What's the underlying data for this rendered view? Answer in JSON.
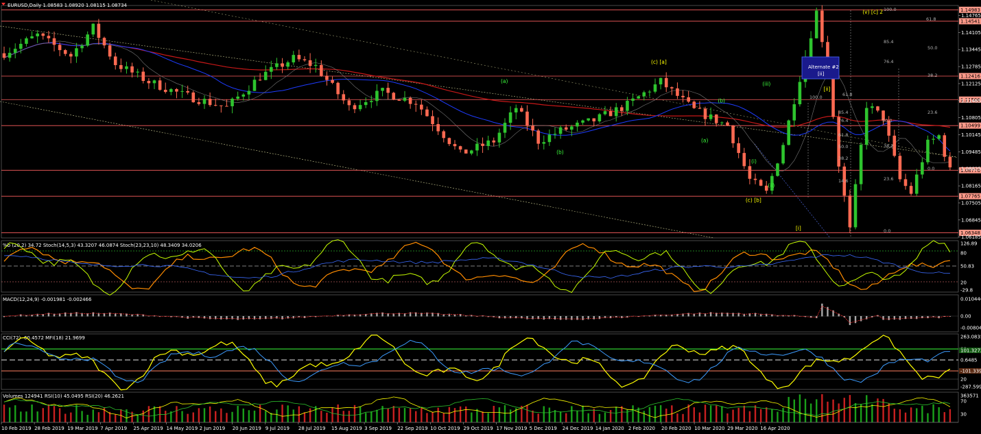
{
  "chart_data": [
    {
      "type": "candlestick",
      "panel": "price",
      "symbol_header": "EURUSD,Daily  1.08583 1.08920 1.08115 1.08734",
      "x_labels": [
        "10 Feb 2019",
        "28 Feb 2019",
        "19 Mar 2019",
        "7 Apr 2019",
        "25 Apr 2019",
        "14 May 2019",
        "2 Jun 2019",
        "20 Jun 2019",
        "9 Jul 2019",
        "28 Jul 2019",
        "15 Aug 2019",
        "3 Sep 2019",
        "22 Sep 2019",
        "10 Oct 2019",
        "29 Oct 2019",
        "17 Nov 2019",
        "5 Dec 2019",
        "24 Dec 2019",
        "14 Jan 2020",
        "2 Feb 2020",
        "20 Feb 2020",
        "10 Mar 2020",
        "29 Mar 2020",
        "16 Apr 2020"
      ],
      "y_ticks": [
        "1.14765",
        "1.14105",
        "1.13445",
        "1.12785",
        "1.12125",
        "1.11465",
        "1.10805",
        "1.10145",
        "1.09485",
        "1.08825",
        "1.08165",
        "1.07505",
        "1.06845",
        "1.06185"
      ],
      "ylim": [
        1.0615,
        1.1515
      ],
      "price_tags": [
        {
          "value": 1.14983,
          "label": "1.14983"
        },
        {
          "value": 1.14541,
          "label": "1.14541"
        },
        {
          "value": 1.12416,
          "label": "1.12416"
        },
        {
          "value": 1.11506,
          "label": "1.11506"
        },
        {
          "value": 1.10499,
          "label": "1.10499"
        },
        {
          "value": 1.0877,
          "label": "1.08770"
        },
        {
          "value": 1.07765,
          "label": "1.07765"
        },
        {
          "value": 1.06348,
          "label": "1.06348"
        }
      ],
      "wave_labels": [
        {
          "text": "(v) [c] 2",
          "date_index": 155,
          "price": 1.1483,
          "color": "#ffff00"
        },
        {
          "text": "(c) [a]",
          "date_index": 117,
          "price": 1.129,
          "color": "#ffff00"
        },
        {
          "text": "(a)",
          "date_index": 90,
          "price": 1.1215,
          "color": "#3cff3c"
        },
        {
          "text": "(b)",
          "date_index": 100,
          "price": 1.094,
          "color": "#3cff3c"
        },
        {
          "text": "(b)",
          "date_index": 129,
          "price": 1.114,
          "color": "#3cff3c"
        },
        {
          "text": "(a)",
          "date_index": 126,
          "price": 1.0985,
          "color": "#3cff3c"
        },
        {
          "text": "(c) [b]",
          "date_index": 134,
          "price": 1.0755,
          "color": "#ffff00"
        },
        {
          "text": "(i)",
          "date_index": 135,
          "price": 1.0905,
          "color": "#3cff3c"
        },
        {
          "text": "(ii)",
          "date_index": 138,
          "price": 1.0812,
          "color": "#3cff3c"
        },
        {
          "text": "(iii)",
          "date_index": 137,
          "price": 1.1205,
          "color": "#3cff3c"
        },
        {
          "text": "[ii]",
          "date_index": 148,
          "price": 1.1185,
          "color": "#ffff00"
        },
        {
          "text": "[i]",
          "date_index": 143,
          "price": 1.0645,
          "color": "#ffff00"
        }
      ],
      "fib_labels_a": [
        "100.0",
        "61.8",
        "50.0",
        "38.2",
        "23.6",
        "0.0"
      ],
      "fib_labels_b": [
        "85.4",
        "76.4"
      ],
      "fib_labels_c": [
        "100.0",
        "61.8",
        "50.0",
        "38.2",
        "23.6",
        "0.0",
        "85.4",
        "76.4",
        "14.6",
        "38.2",
        "50.0",
        "61.8"
      ],
      "alternate_box": {
        "line1": "Alternate #2",
        "line2": "[ii]"
      }
    },
    {
      "type": "line",
      "panel": "stochastic",
      "header": "%b (20,2) 34.72  Stoch(14,5,3) 43.3207 46.0874  Stoch(23,23,10) 48.3409 34.0206",
      "right_labels": [
        "126.89",
        "80",
        "50.83",
        "20",
        "-29.8"
      ]
    },
    {
      "type": "histogram",
      "panel": "macd",
      "header": "MACD(12,24,9) -0.001981 -0.002466",
      "right_labels": [
        "0.010446",
        "0.00",
        "-0.008049"
      ]
    },
    {
      "type": "line",
      "panel": "cci_mfi",
      "header": "CCI(72) -60.4572  MFI(18) 21.9699",
      "right_labels": [
        "263.0835",
        "80",
        "101.3272",
        "0.6485",
        "-101.3392",
        "20",
        "-287.5997"
      ]
    },
    {
      "type": "bar",
      "panel": "volume_rsi",
      "header": "Volumes 124941  RSI(10) 45.0495  RSI(20) 46.2621",
      "right_labels": [
        "363571",
        "70",
        "30"
      ]
    }
  ],
  "colors": {
    "bull": "#2ec42e",
    "bear": "#ff6a52",
    "ma_red": "#c81818",
    "ma_blue": "#1e3cff",
    "hline": "#ff6060",
    "alt_box": "#1a1a8c"
  }
}
